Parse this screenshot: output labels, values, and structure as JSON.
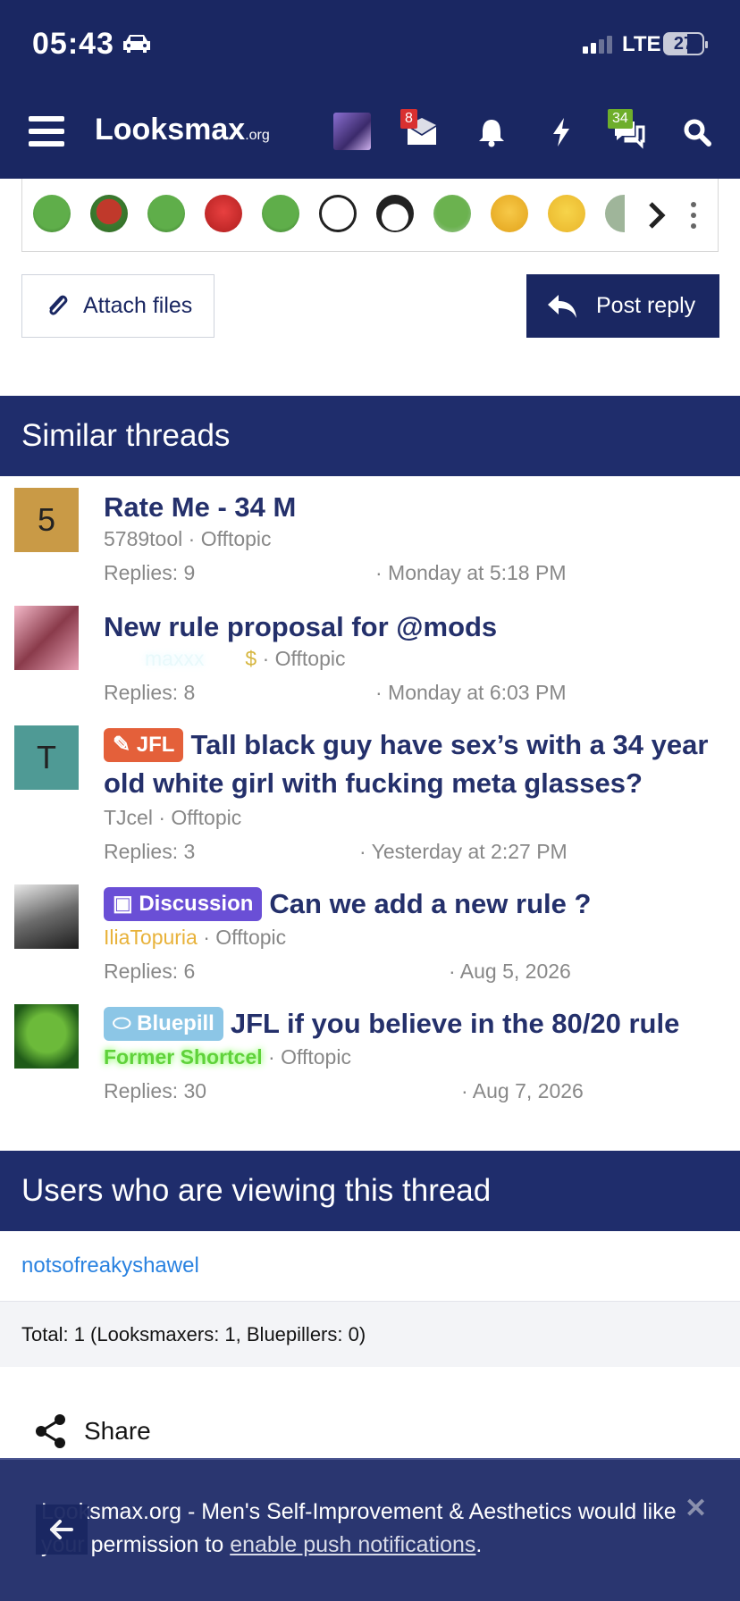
{
  "status_bar": {
    "time": "05:43",
    "network": "LTE",
    "battery": "27"
  },
  "header": {
    "logo_main": "Looksmax",
    "logo_suffix": ".org",
    "inbox_badge": "8",
    "chat_badge": "34"
  },
  "composer": {
    "attach_label": "Attach files",
    "reply_label": "Post reply"
  },
  "similar": {
    "heading": "Similar threads",
    "threads": [
      {
        "avatar_letter": "5",
        "prefix": "",
        "title": "Rate Me - 34 M",
        "author": "5789tool",
        "forum": "Offtopic",
        "replies": "Replies: 9",
        "date": "· Monday at 5:18 PM"
      },
      {
        "avatar_letter": "",
        "prefix": "",
        "title": "New rule proposal for @mods",
        "author": "maxxx",
        "forum": "Offtopic",
        "replies": "Replies: 8",
        "date": "· Monday at 6:03 PM"
      },
      {
        "avatar_letter": "T",
        "prefix": "JFL",
        "title": "Tall black guy have sex’s with a 34 year old white girl with fucking meta glasses?",
        "author": "TJcel",
        "forum": "Offtopic",
        "replies": "Replies: 3",
        "date": "· Yesterday at 2:27 PM"
      },
      {
        "avatar_letter": "",
        "prefix": "Discussion",
        "title": "Can we add a new rule ?",
        "author": "IliaTopuria",
        "forum": "Offtopic",
        "replies": "Replies: 6",
        "date": "· Aug 5, 2026"
      },
      {
        "avatar_letter": "",
        "prefix": "Bluepill",
        "title": "JFL if you believe in the 80/20 rule",
        "author": "Former Shortcel",
        "forum": "Offtopic",
        "replies": "Replies: 30",
        "date": "· Aug 7, 2026"
      }
    ]
  },
  "viewers": {
    "heading": "Users who are viewing this thread",
    "user": "notsofreakyshawel",
    "total": "Total: 1 (Looksmaxers: 1, Bluepillers: 0)"
  },
  "share_label": "Share",
  "push": {
    "text_before": "Looksmax.org - Men's Self-Improvement & Aesthetics would like your permission to ",
    "link": "enable push notifications",
    "text_after": "."
  },
  "colors": {
    "brand_navy": "#1a2762",
    "title_navy": "#24306b",
    "link_blue": "#2a82e0",
    "jfl": "#e4603a",
    "discussion": "#6a4fd6",
    "bluepill": "#8cc6e6"
  }
}
